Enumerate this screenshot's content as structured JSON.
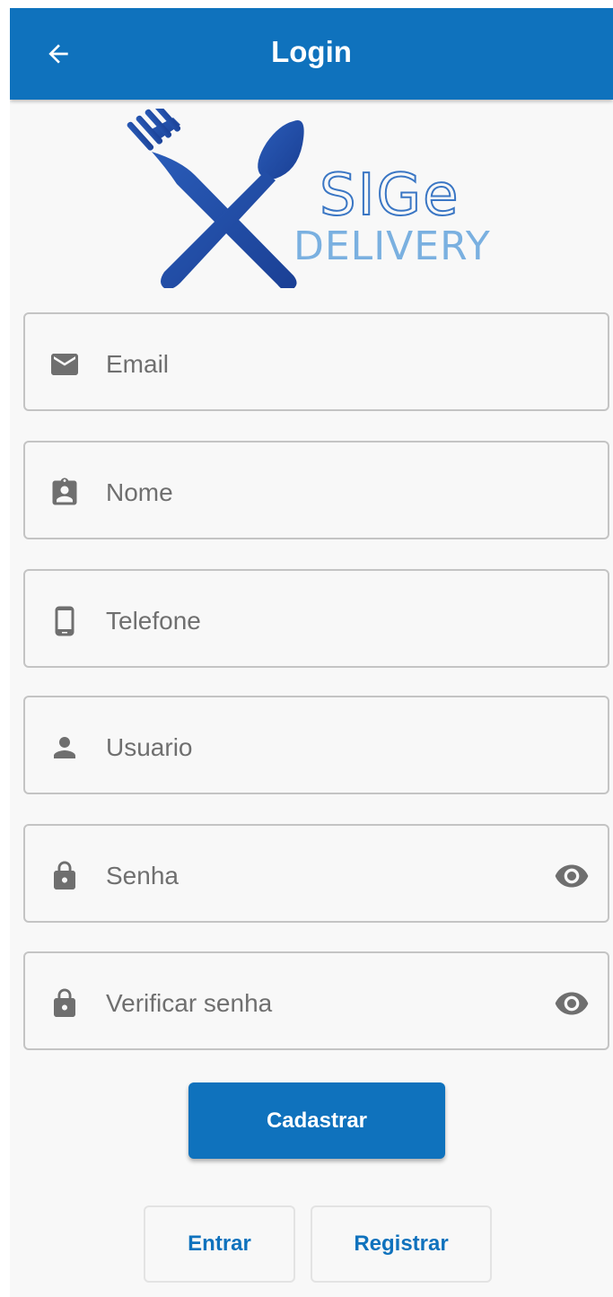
{
  "appbar": {
    "title": "Login",
    "back_icon": "arrow-back-icon"
  },
  "logo": {
    "line1": "SIGe",
    "line2": "DELIVERY"
  },
  "form": {
    "email": {
      "placeholder": "Email",
      "icon": "mail-icon"
    },
    "nome": {
      "placeholder": "Nome",
      "icon": "badge-icon"
    },
    "telefone": {
      "placeholder": "Telefone",
      "icon": "phone-icon"
    },
    "usuario": {
      "placeholder": "Usuario",
      "icon": "person-icon"
    },
    "senha": {
      "placeholder": "Senha",
      "icon": "lock-icon",
      "toggle_icon": "eye-icon"
    },
    "verificar": {
      "placeholder": "Verificar senha",
      "icon": "lock-icon",
      "toggle_icon": "eye-icon"
    }
  },
  "actions": {
    "primary_label": "Cadastrar",
    "login_label": "Entrar",
    "register_label": "Registrar"
  },
  "colors": {
    "primary": "#0f72bd",
    "icon_gray": "#6f6f6f",
    "logo_blue": "#1b4fa5"
  }
}
